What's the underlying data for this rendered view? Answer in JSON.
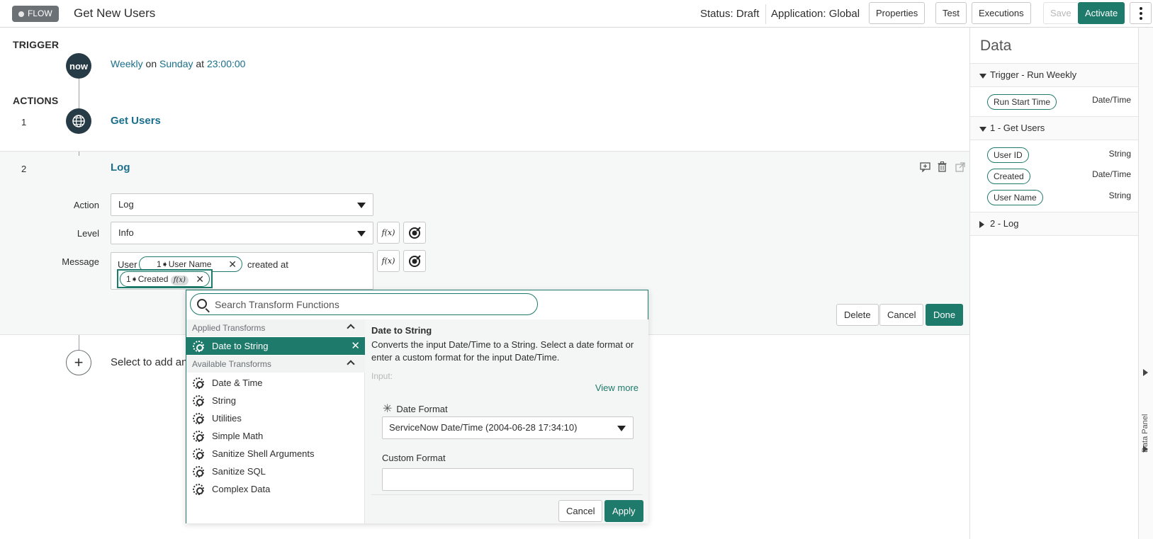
{
  "header": {
    "badge": "FLOW",
    "title": "Get New Users",
    "status": "Status: Draft",
    "application": "Application: Global",
    "buttons": {
      "properties": "Properties",
      "test": "Test",
      "executions": "Executions",
      "save": "Save",
      "activate": "Activate"
    }
  },
  "canvas": {
    "trigger_label": "TRIGGER",
    "actions_label": "ACTIONS",
    "trigger": {
      "icon": "now",
      "frequency": "Weekly",
      "on_word": "on",
      "day": "Sunday",
      "at_word": "at",
      "time": "23:00:00"
    },
    "steps": [
      {
        "number": "1",
        "icon": "globe-icon",
        "title": "Get Users"
      },
      {
        "number": "2",
        "icon": "now",
        "title": "Log"
      }
    ],
    "log_form": {
      "action_label": "Action",
      "action_value": "Log",
      "level_label": "Level",
      "level_value": "Info",
      "message_label": "Message",
      "message_prefix": "User",
      "pill_user_name": "1➧User Name",
      "message_middle": "created at",
      "pill_created": "1➧Created",
      "fx_badge": "f(x)",
      "fx_button": "f(x)",
      "buttons": {
        "delete": "Delete",
        "cancel": "Cancel",
        "done": "Done"
      }
    },
    "add_action_text": "Select to add an A"
  },
  "transform_popover": {
    "search_placeholder": "Search Transform Functions",
    "applied_header": "Applied Transforms",
    "applied": [
      "Date to String"
    ],
    "available_header": "Available Transforms",
    "available": [
      "Date & Time",
      "String",
      "Utilities",
      "Simple Math",
      "Sanitize Shell Arguments",
      "Sanitize SQL",
      "Complex Data"
    ],
    "detail": {
      "title": "Date to String",
      "description": "Converts the input Date/Time to a String. Select a date format or enter a custom format for the input Date/Time.",
      "input_label": "Input:",
      "view_more": "View more",
      "date_format_label": "Date Format",
      "date_format_value": "ServiceNow Date/Time (2004-06-28 17:34:10)",
      "custom_format_label": "Custom Format",
      "custom_format_value": "",
      "cancel": "Cancel",
      "apply": "Apply"
    }
  },
  "data_panel": {
    "title": "Data",
    "side_label": "Data Panel",
    "sections": [
      {
        "title": "Trigger - Run Weekly",
        "expanded": true,
        "items": [
          {
            "name": "Run Start Time",
            "type": "Date/Time"
          }
        ]
      },
      {
        "title": "1 - Get Users",
        "expanded": true,
        "items": [
          {
            "name": "User ID",
            "type": "String"
          },
          {
            "name": "Created",
            "type": "Date/Time"
          },
          {
            "name": "User Name",
            "type": "String"
          }
        ]
      },
      {
        "title": "2 - Log",
        "expanded": false,
        "items": []
      }
    ]
  },
  "colors": {
    "accent": "#1e7a6a",
    "link": "#1a6f8c",
    "step_icon_bg": "#263b46",
    "badge_bg": "#6b7175"
  }
}
